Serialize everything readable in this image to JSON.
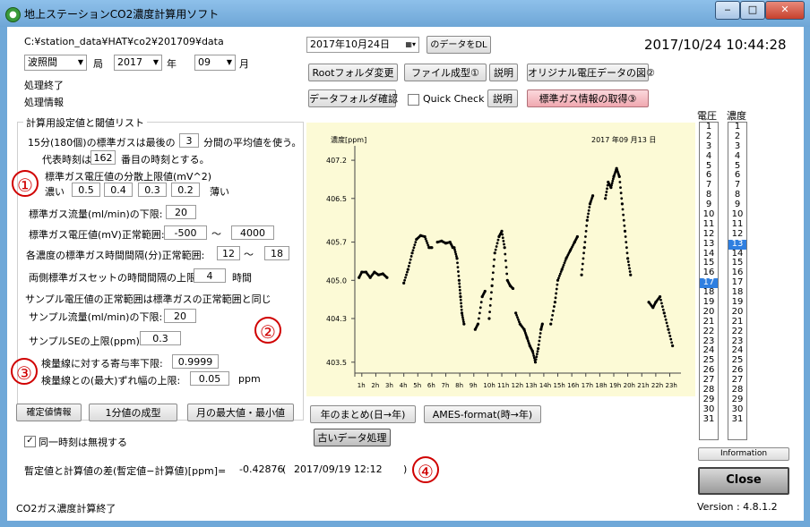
{
  "window": {
    "title": "地上ステーションCO2濃度計算用ソフト",
    "min_label": "‒",
    "max_label": "□",
    "close_label": "✕"
  },
  "path": "C:¥station_data¥HAT¥co2¥201709¥data",
  "station_combo": "波照間",
  "station_suffix": "局",
  "year_combo": "2017",
  "year_suffix": "年",
  "month_combo": "09",
  "month_suffix": "月",
  "status1": "処理終了",
  "status2": "処理情報",
  "date_picker": "2017年10月24日",
  "dl_button": "のデータをDL",
  "clock": "2017/10/24 10:44:28",
  "buttons": {
    "root": "Rootフォルダ変更",
    "file": "ファイル成型①",
    "explain1": "説明",
    "orig": "オリジナル電圧データの図②",
    "datafolder": "データフォルダ確認",
    "quick": "Quick Check",
    "explain2": "説明",
    "std": "標準ガス情報の取得③",
    "confirm": "確定値情報",
    "min1": "1分値の成型",
    "monthmax": "月の最大値・最小値",
    "yearsum": "年のまとめ(日→年)",
    "ames": "AMES-format(時→年)",
    "old": "古いデータ処理",
    "info": "Information",
    "close": "Close"
  },
  "settings": {
    "title": "計算用設定値と閾値リスト",
    "l1a": "15分(180個)の標準ガスは最後の",
    "l1v": "3",
    "l1b": "分間の平均値を使う。",
    "l2a": "代表時刻は",
    "l2v": "162",
    "l2b": "番目の時刻とする。",
    "l3": "標準ガス電圧値の分散上限値(mV^2)",
    "dense": "濃い",
    "v1": "0.5",
    "v2": "0.4",
    "v3": "0.3",
    "v4": "0.2",
    "thin": "薄い",
    "l4": "標準ガス流量(ml/min)の下限:",
    "l4v": "20",
    "l5": "標準ガス電圧値(mV)正常範囲:",
    "l5a": "-500",
    "tilde1": "～",
    "l5b": "4000",
    "l6": "各濃度の標準ガス時間間隔(分)正常範囲:",
    "l6a": "12",
    "tilde2": "～",
    "l6b": "18",
    "l7": "両側標準ガスセットの時間間隔の上限:",
    "l7v": "4",
    "l7u": "時間",
    "l8": "サンプル電圧値の正常範囲は標準ガスの正常範囲と同じ",
    "l9": "サンプル流量(ml/min)の下限:",
    "l9v": "20",
    "l10": "サンプルSEの上限(ppm):",
    "l10v": "0.3",
    "l11": "検量線に対する寄与率下限:",
    "l11v": "0.9999",
    "l12": "検量線との(最大)ずれ幅の上限:",
    "l12v": "0.05",
    "l12u": "ppm"
  },
  "markers": {
    "m1": "①",
    "m2": "②",
    "m3": "③",
    "m4": "④"
  },
  "checkbox_label": "同一時刻は無視する",
  "checkbox_mark": "✓",
  "diff_label": "暫定値と計算値の差(暫定値−計算値)[ppm]=",
  "diff_value": "-0.42876",
  "diff_paren": "(",
  "diff_time": "2017/09/19 12:12",
  "diff_close": ")",
  "footer_status": "CO2ガス濃度計算終了",
  "version": "Version : 4.8.1.2",
  "list_headers": {
    "voltage": "電圧",
    "conc": "濃度"
  },
  "voltage_list": [
    "1",
    "2",
    "3",
    "4",
    "5",
    "6",
    "7",
    "8",
    "9",
    "10",
    "11",
    "12",
    "13",
    "14",
    "15",
    "16",
    "17",
    "18",
    "19",
    "20",
    "21",
    "22",
    "23",
    "24",
    "25",
    "26",
    "27",
    "28",
    "29",
    "30",
    "31"
  ],
  "conc_list": [
    "1",
    "2",
    "3",
    "4",
    "5",
    "6",
    "7",
    "8",
    "9",
    "10",
    "11",
    "12",
    "13",
    "14",
    "15",
    "16",
    "17",
    "18",
    "19",
    "20",
    "21",
    "22",
    "23",
    "24",
    "25",
    "26",
    "27",
    "28",
    "29",
    "30",
    "31"
  ],
  "voltage_selected": "17",
  "conc_selected": "13",
  "chart_data": {
    "type": "scatter",
    "ylabel": "濃度[ppm]",
    "date_label": "2017 年09 月13 日",
    "ylim": [
      403.3,
      407.3
    ],
    "yticks": [
      "407.2",
      "406.5",
      "405.7",
      "405.0",
      "404.3",
      "403.5"
    ],
    "ytick_values": [
      407.2,
      406.5,
      405.7,
      405.0,
      404.3,
      403.5
    ],
    "xticks": [
      "1h",
      "2h",
      "3h",
      "4h",
      "5h",
      "6h",
      "7h",
      "8h",
      "9h",
      "10h",
      "11h",
      "12h",
      "13h",
      "14h",
      "15h",
      "16h",
      "17h",
      "18h",
      "19h",
      "20h",
      "21h",
      "22h",
      "23h"
    ],
    "color": "#000000",
    "segments": [
      [
        [
          0.8,
          405.05
        ],
        [
          1.0,
          405.15
        ],
        [
          1.3,
          405.15
        ],
        [
          1.6,
          405.05
        ],
        [
          1.9,
          405.15
        ],
        [
          2.2,
          405.1
        ],
        [
          2.5,
          405.12
        ],
        [
          2.8,
          405.05
        ]
      ],
      [
        [
          4.0,
          404.95
        ],
        [
          4.3,
          405.2
        ],
        [
          4.6,
          405.5
        ],
        [
          4.9,
          405.75
        ],
        [
          5.2,
          405.82
        ],
        [
          5.5,
          405.8
        ],
        [
          5.8,
          405.6
        ],
        [
          6.0,
          405.6
        ]
      ],
      [
        [
          6.4,
          405.7
        ],
        [
          6.7,
          405.72
        ],
        [
          7.0,
          405.68
        ],
        [
          7.3,
          405.7
        ],
        [
          7.5,
          405.6
        ]
      ],
      [
        [
          7.6,
          405.6
        ],
        [
          7.8,
          405.4
        ],
        [
          7.95,
          405.0
        ],
        [
          8.05,
          404.7
        ],
        [
          8.15,
          404.4
        ],
        [
          8.3,
          404.2
        ]
      ],
      [
        [
          9.1,
          404.1
        ],
        [
          9.3,
          404.2
        ],
        [
          9.6,
          404.7
        ],
        [
          9.8,
          404.8
        ]
      ],
      [
        [
          10.1,
          404.3
        ],
        [
          10.3,
          404.9
        ],
        [
          10.5,
          405.5
        ],
        [
          10.8,
          405.8
        ],
        [
          11.0,
          405.9
        ],
        [
          11.2,
          405.6
        ],
        [
          11.4,
          405.0
        ],
        [
          11.6,
          404.9
        ],
        [
          11.8,
          404.85
        ]
      ],
      [
        [
          12.0,
          404.4
        ],
        [
          12.3,
          404.2
        ],
        [
          12.6,
          404.1
        ],
        [
          12.8,
          403.95
        ],
        [
          13.0,
          403.8
        ],
        [
          13.2,
          403.7
        ],
        [
          13.4,
          403.5
        ],
        [
          13.6,
          403.75
        ],
        [
          13.8,
          404.1
        ],
        [
          13.9,
          404.2
        ]
      ],
      [
        [
          14.5,
          404.2
        ],
        [
          14.8,
          404.6
        ],
        [
          15.0,
          405.0
        ],
        [
          15.3,
          405.2
        ],
        [
          15.6,
          405.4
        ],
        [
          15.9,
          405.55
        ],
        [
          16.2,
          405.7
        ],
        [
          16.4,
          405.8
        ]
      ],
      [
        [
          16.7,
          405.1
        ],
        [
          16.9,
          405.6
        ],
        [
          17.1,
          406.1
        ],
        [
          17.3,
          406.4
        ],
        [
          17.5,
          406.55
        ]
      ],
      [
        [
          18.4,
          406.5
        ],
        [
          18.6,
          406.8
        ],
        [
          18.8,
          406.7
        ],
        [
          19.0,
          406.9
        ],
        [
          19.2,
          407.05
        ],
        [
          19.4,
          406.9
        ],
        [
          19.6,
          406.4
        ],
        [
          19.8,
          405.9
        ],
        [
          20.0,
          405.4
        ],
        [
          20.2,
          405.1
        ]
      ],
      [
        [
          21.5,
          404.6
        ],
        [
          21.8,
          404.5
        ],
        [
          22.0,
          404.6
        ],
        [
          22.3,
          404.7
        ],
        [
          22.6,
          404.4
        ],
        [
          22.9,
          404.1
        ],
        [
          23.2,
          403.8
        ]
      ]
    ]
  }
}
